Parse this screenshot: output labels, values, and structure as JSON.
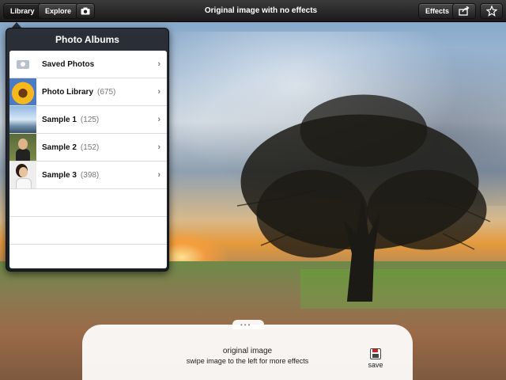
{
  "toolbar": {
    "library_label": "Library",
    "explore_label": "Explore",
    "camera_icon": "camera-icon",
    "title": "Original image with no effects",
    "effects_label": "Effects",
    "share_icon": "share-icon",
    "star_icon": "star-icon"
  },
  "popover": {
    "title": "Photo Albums",
    "items": [
      {
        "label": "Saved Photos",
        "count": ""
      },
      {
        "label": "Photo Library",
        "count": "(675)"
      },
      {
        "label": "Sample 1",
        "count": "(125)"
      },
      {
        "label": "Sample 2",
        "count": "(152)"
      },
      {
        "label": "Sample 3",
        "count": "(398)"
      }
    ]
  },
  "bottom": {
    "line1": "original image",
    "line2": "swipe image to the left for more effects",
    "save_label": "save"
  }
}
